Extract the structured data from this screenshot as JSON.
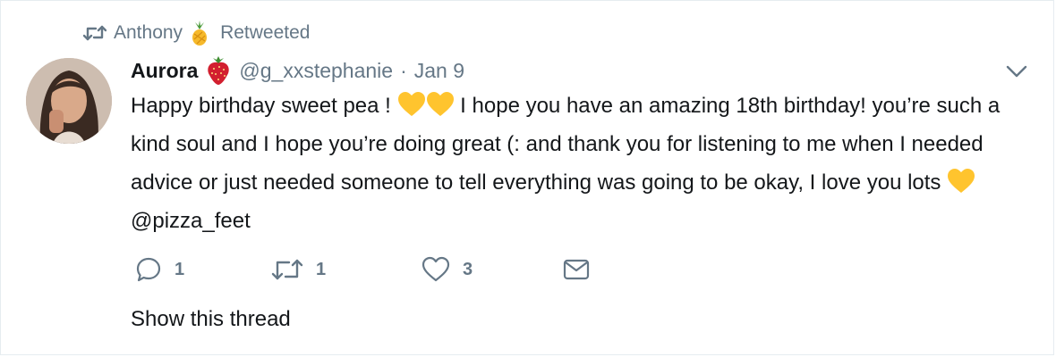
{
  "context": {
    "retweeter": "Anthony",
    "retweeter_emoji": "pineapple-icon",
    "label": "Retweeted"
  },
  "tweet": {
    "name": "Aurora",
    "name_emoji": "strawberry-icon",
    "handle": "@g_xxstephanie",
    "separator": "·",
    "date": "Jan 9",
    "text_part1": "Happy birthday sweet pea ! ",
    "text_part2": " I hope you have an amazing 18th birthday! you’re such a kind soul and I hope you’re doing great (: and thank you for listening to me when I needed advice or just needed someone to tell everything was going to be okay, I love you lots ",
    "text_part3": " @pizza_feet",
    "heart_color": "#ffc42e"
  },
  "actions": {
    "reply_count": "1",
    "retweet_count": "1",
    "like_count": "3"
  },
  "show_thread": "Show this thread",
  "colors": {
    "muted": "#657786",
    "text": "#14171a",
    "border": "#e6ecf0"
  }
}
